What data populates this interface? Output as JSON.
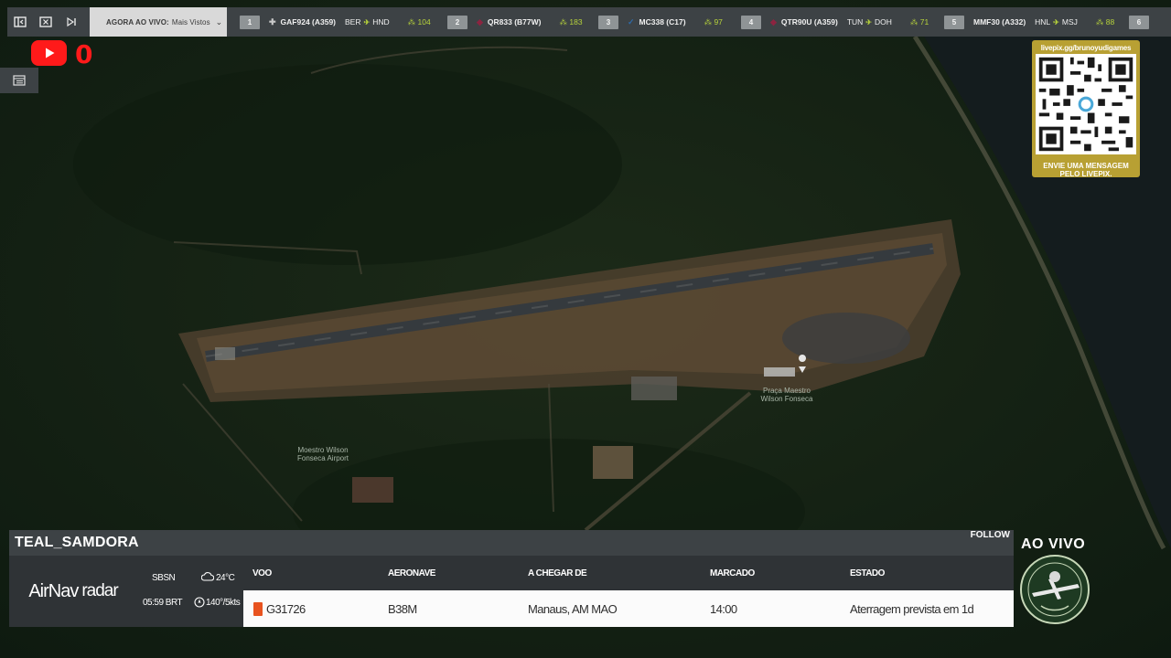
{
  "topbar": {
    "dropdown": {
      "label_strong": "AGORA AO VIVO:",
      "label_value": "Mais Vistos"
    },
    "flights": [
      {
        "rank": "1",
        "callsign": "GAF924 (A359)",
        "from": "BER",
        "to": "HND",
        "count": "104"
      },
      {
        "rank": "2",
        "callsign": "QR833 (B77W)",
        "from": "",
        "to": "",
        "count": "183"
      },
      {
        "rank": "3",
        "callsign": "MC338 (C17)",
        "from": "",
        "to": "",
        "count": "97"
      },
      {
        "rank": "4",
        "callsign": "QTR90U (A359)",
        "from": "TUN",
        "to": "DOH",
        "count": "71"
      },
      {
        "rank": "5",
        "callsign": "MMF30 (A332)",
        "from": "HNL",
        "to": "MSJ",
        "count": "88"
      },
      {
        "rank": "6",
        "callsign": "",
        "from": "",
        "to": "",
        "count": ""
      }
    ]
  },
  "overlay": {
    "youtube_count": "0"
  },
  "qr": {
    "url": "livepix.gg/brunoyudigames",
    "message": "ENVIE UMA MENSAGEM PELO LIVEPIX."
  },
  "map": {
    "airport_label": "Moestro Wilson Fonseca Airport",
    "terminal_label": "Praça Maestro Wilson Fonseca"
  },
  "board": {
    "title": "TEAL_SAMDORA",
    "follow": "FOLLOW",
    "brand_bold": "AirNav",
    "brand_rest": "radar",
    "station": {
      "icao": "SBSN",
      "time": "05:59 BRT",
      "temp": "24°C",
      "wind": "140°/5kts"
    },
    "columns": {
      "flight": "VOO",
      "aircraft": "AERONAVE",
      "origin": "A CHEGAR DE",
      "scheduled": "MARCADO",
      "status": "ESTADO"
    },
    "row": {
      "flight": "G31726",
      "aircraft": "B38M",
      "origin": "Manaus, AM MAO",
      "scheduled": "14:00",
      "status": "Aterragem prevista em 1d"
    }
  },
  "live": {
    "label": "AO VIVO"
  },
  "colors": {
    "bar_bg": "#3d4245",
    "accent_green": "#b7d33b",
    "youtube_red": "#ff1a1a",
    "qr_gold": "#b8a033",
    "airline_orange": "#e8531f"
  }
}
